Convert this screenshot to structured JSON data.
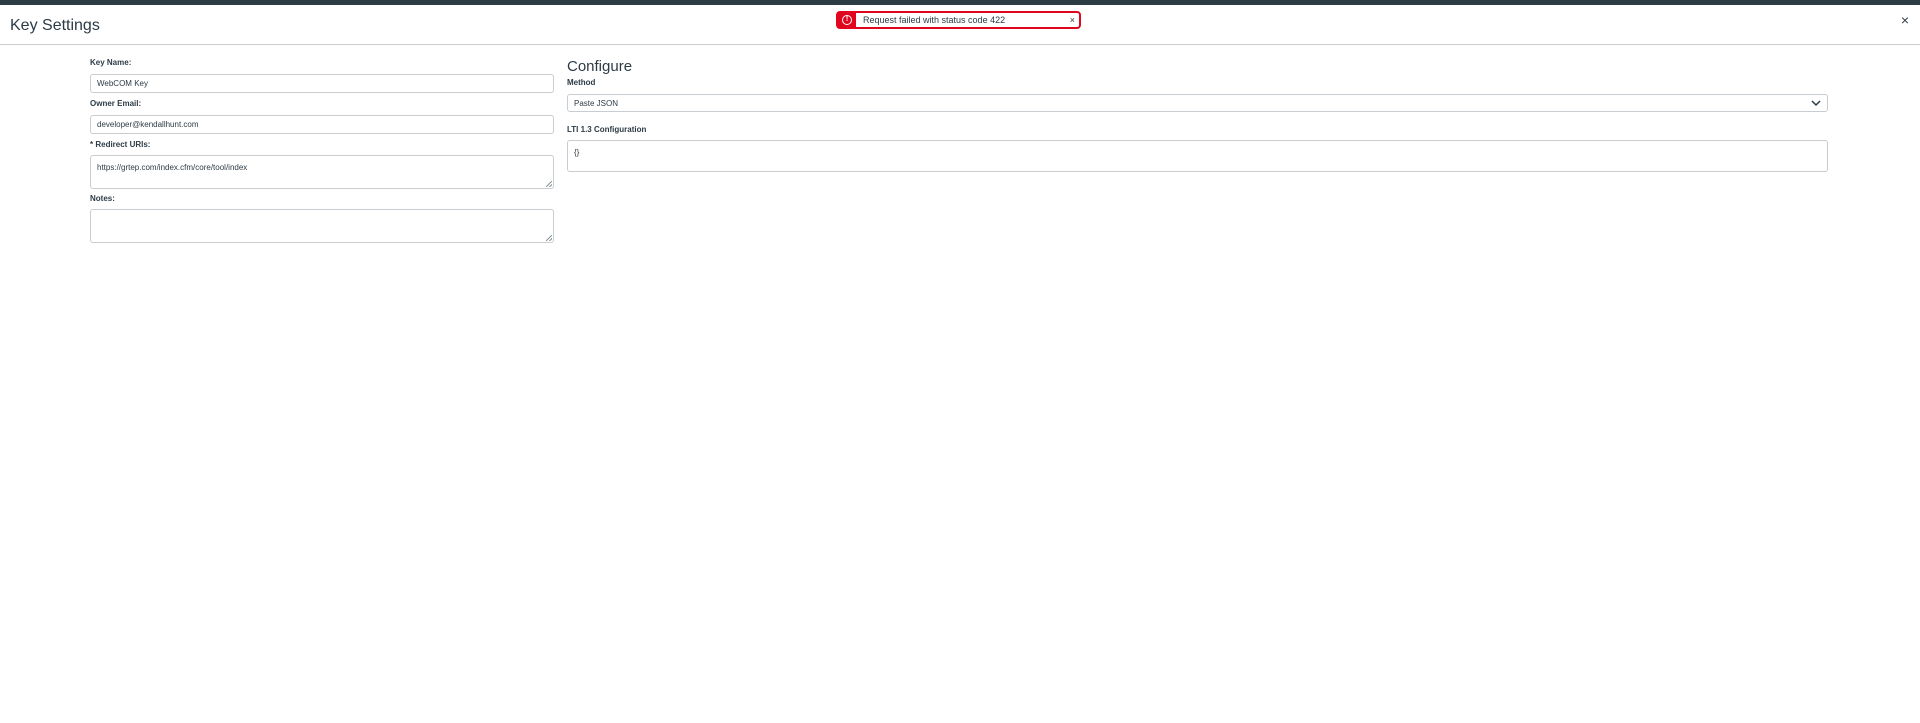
{
  "header": {
    "title": "Key Settings",
    "close_icon": "close-icon",
    "close_glyph": "×"
  },
  "alert": {
    "message": "Request failed with status code 422",
    "icon": "warning-icon",
    "icon_glyph": "!",
    "close_glyph": "×",
    "color": "#e0061f"
  },
  "form": {
    "key_name_label": "Key Name:",
    "key_name_value": "WebCOM Key",
    "owner_email_label": "Owner Email:",
    "owner_email_value": "developer@kendallhunt.com",
    "redirect_uris_label": "* Redirect URIs:",
    "redirect_uris_value": "https://grtep.com/index.cfm/core/tool/index",
    "notes_label": "Notes:",
    "notes_value": ""
  },
  "configure": {
    "title": "Configure",
    "method_label": "Method",
    "method_value": "Paste JSON",
    "lti_label": "LTI 1.3 Configuration",
    "lti_value": "{}"
  },
  "colors": {
    "text": "#2d3b45",
    "border": "#c7cdd1",
    "error": "#e0061f"
  }
}
